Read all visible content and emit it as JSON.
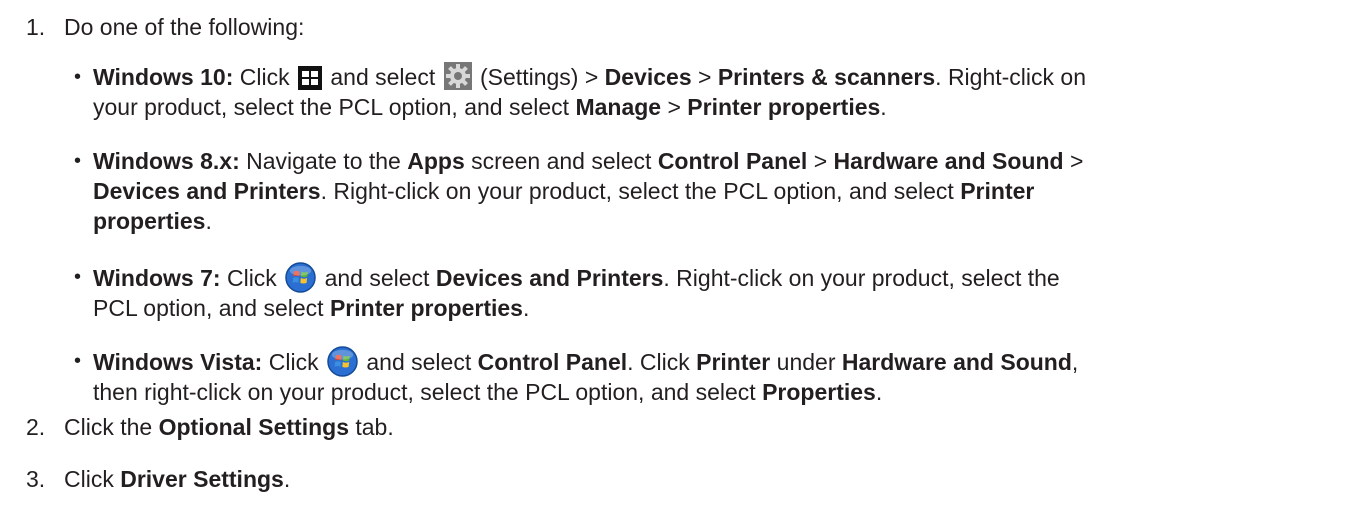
{
  "steps": [
    {
      "number": "1.",
      "text": "Do one of the following:"
    },
    {
      "number": "2.",
      "pre": "Click the ",
      "bold": "Optional Settings",
      "post": " tab."
    },
    {
      "number": "3.",
      "pre": "Click ",
      "bold": "Driver Settings",
      "post": "."
    }
  ],
  "windows10": {
    "label": "Windows 10:",
    "click": " Click ",
    "and_select": " and select ",
    "settings_paren": " (Settings) > ",
    "devices": "Devices",
    "gt": " > ",
    "printers_scanners": "Printers & scanners",
    "rest1": ". Right-click on",
    "rest2": "your product, select the PCL option, and select ",
    "manage": "Manage",
    "printer_properties": "Printer properties",
    "end": "."
  },
  "windows8": {
    "label": "Windows 8.x:",
    "navigate": " Navigate to the ",
    "apps": "Apps",
    "screen_select": " screen and select ",
    "control_panel": "Control Panel",
    "gt": " > ",
    "hardware_sound": "Hardware and Sound",
    "gt_end": " >",
    "devices_printers": "Devices and Printers",
    "rest": ". Right-click on your product, select the PCL option, and select ",
    "printer": "Printer",
    "properties": "properties",
    "end": "."
  },
  "windows7": {
    "label": "Windows 7:",
    "click": " Click ",
    "and_select": " and select ",
    "devices_printers": "Devices and Printers",
    "rest1": ". Right-click on your product, select the",
    "rest2": "PCL option, and select ",
    "printer_properties": "Printer properties",
    "end": "."
  },
  "windowsvista": {
    "label": "Windows Vista:",
    "click": " Click ",
    "and_select": " and select ",
    "control_panel": "Control Panel",
    "click_printer": ". Click ",
    "printer": "Printer",
    "under": " under ",
    "hardware_sound": "Hardware and Sound",
    "comma": ",",
    "rest": "then right-click on your product, select the PCL option, and select ",
    "properties": "Properties",
    "end": "."
  },
  "icons": {
    "windows10_start": "windows-logo-icon",
    "settings": "gear-icon",
    "windows7_start": "windows-orb-icon"
  },
  "colors": {
    "text": "#231f20",
    "orb_blue": "#2a6fd1",
    "orb_red": "#e8462c",
    "orb_green": "#5db534",
    "orb_yellow": "#f6c22f"
  }
}
